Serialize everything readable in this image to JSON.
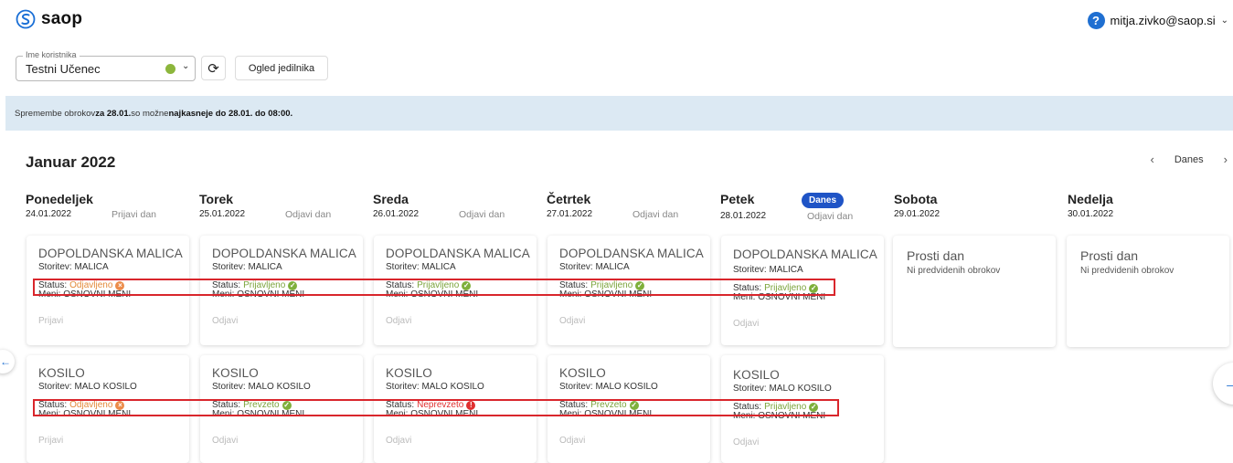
{
  "app": {
    "brand": "saop",
    "user_email": "mitja.zivko@saop.si",
    "help_label": "?"
  },
  "toolbar": {
    "user_select_legend": "Ime koristnika",
    "user_select_value": "Testni Učenec",
    "menu_button_label": "Ogled jedilnika"
  },
  "notice": {
    "part1": "Spremembe obrokov ",
    "bold1": "za 28.01.",
    "part2": " so možne ",
    "bold2": "najkasneje do 28.01. do 08:00."
  },
  "calendar": {
    "month_label": "Januar 2022",
    "today_label": "Danes",
    "days": [
      {
        "name": "Ponedeljek",
        "date": "24.01.2022",
        "action": "Prijavi dan"
      },
      {
        "name": "Torek",
        "date": "25.01.2022",
        "action": "Odjavi dan"
      },
      {
        "name": "Sreda",
        "date": "26.01.2022",
        "action": "Odjavi dan"
      },
      {
        "name": "Četrtek",
        "date": "27.01.2022",
        "action": "Odjavi dan"
      },
      {
        "name": "Petek",
        "date": "28.01.2022",
        "action": "Odjavi dan",
        "badge": "Danes"
      },
      {
        "name": "Sobota",
        "date": "29.01.2022"
      },
      {
        "name": "Nedelja",
        "date": "30.01.2022"
      }
    ],
    "labels": {
      "service_prefix": "Storitev: ",
      "status_prefix": "Status: ",
      "menu_prefix": "Meni: "
    },
    "malica_cards": [
      {
        "title": "DOPOLDANSKA MALICA",
        "service": "MALICA",
        "status": "Odjavljeno",
        "status_kind": "orange",
        "menu": "OSNOVNI MENI",
        "action": "Prijavi"
      },
      {
        "title": "DOPOLDANSKA MALICA",
        "service": "MALICA",
        "status": "Prijavljeno",
        "status_kind": "green",
        "menu": "OSNOVNI MENI",
        "action": "Odjavi"
      },
      {
        "title": "DOPOLDANSKA MALICA",
        "service": "MALICA",
        "status": "Prijavljeno",
        "status_kind": "green",
        "menu": "OSNOVNI MENI",
        "action": "Odjavi"
      },
      {
        "title": "DOPOLDANSKA MALICA",
        "service": "MALICA",
        "status": "Prijavljeno",
        "status_kind": "green",
        "menu": "OSNOVNI MENI",
        "action": "Odjavi"
      },
      {
        "title": "DOPOLDANSKA MALICA",
        "service": "MALICA",
        "status": "Prijavljeno",
        "status_kind": "green",
        "menu": "OSNOVNI MENI",
        "action": "Odjavi"
      }
    ],
    "kosilo_cards": [
      {
        "title": "KOSILO",
        "service": "MALO KOSILO",
        "status": "Odjavljeno",
        "status_kind": "orange",
        "menu": "OSNOVNI MENI",
        "action": "Prijavi"
      },
      {
        "title": "KOSILO",
        "service": "MALO KOSILO",
        "status": "Prevzeto",
        "status_kind": "green",
        "menu": "OSNOVNI MENI",
        "action": "Odjavi"
      },
      {
        "title": "KOSILO",
        "service": "MALO KOSILO",
        "status": "Neprevzeto",
        "status_kind": "red",
        "menu": "OSNOVNI MENI",
        "action": "Odjavi"
      },
      {
        "title": "KOSILO",
        "service": "MALO KOSILO",
        "status": "Prevzeto",
        "status_kind": "green",
        "menu": "OSNOVNI MENI",
        "action": "Odjavi"
      },
      {
        "title": "KOSILO",
        "service": "MALO KOSILO",
        "status": "Prijavljeno",
        "status_kind": "green",
        "menu": "OSNOVNI MENI",
        "action": "Odjavi"
      }
    ],
    "free_days": [
      {
        "title": "Prosti dan",
        "sub": "Ni predvidenih obrokov"
      },
      {
        "title": "Prosti dan",
        "sub": "Ni predvidenih obrokov"
      }
    ]
  },
  "colors": {
    "accent": "#1f6fd1",
    "today_badge": "#1f54c6",
    "ok": "#7fb03b",
    "cancelled": "#ec8c4a",
    "error": "#e03030",
    "highlight": "#d9262c"
  }
}
